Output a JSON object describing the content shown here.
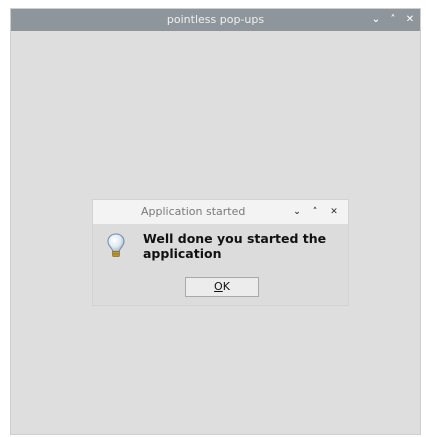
{
  "window": {
    "title": "pointless pop-ups",
    "minimize_glyph": "⌄",
    "maximize_glyph": "˄",
    "close_glyph": "✕"
  },
  "dialog": {
    "title": "Application started",
    "minimize_glyph": "⌄",
    "maximize_glyph": "˄",
    "close_glyph": "✕",
    "icon": "lightbulb-icon",
    "message": "Well done you started the application",
    "ok_label": "OK",
    "ok_mnemonic": "O",
    "ok_rest": "K"
  },
  "colors": {
    "titlebar": "#8f969b",
    "window_bg": "#dedede",
    "dialog_titlebar": "#f3f3f3"
  }
}
